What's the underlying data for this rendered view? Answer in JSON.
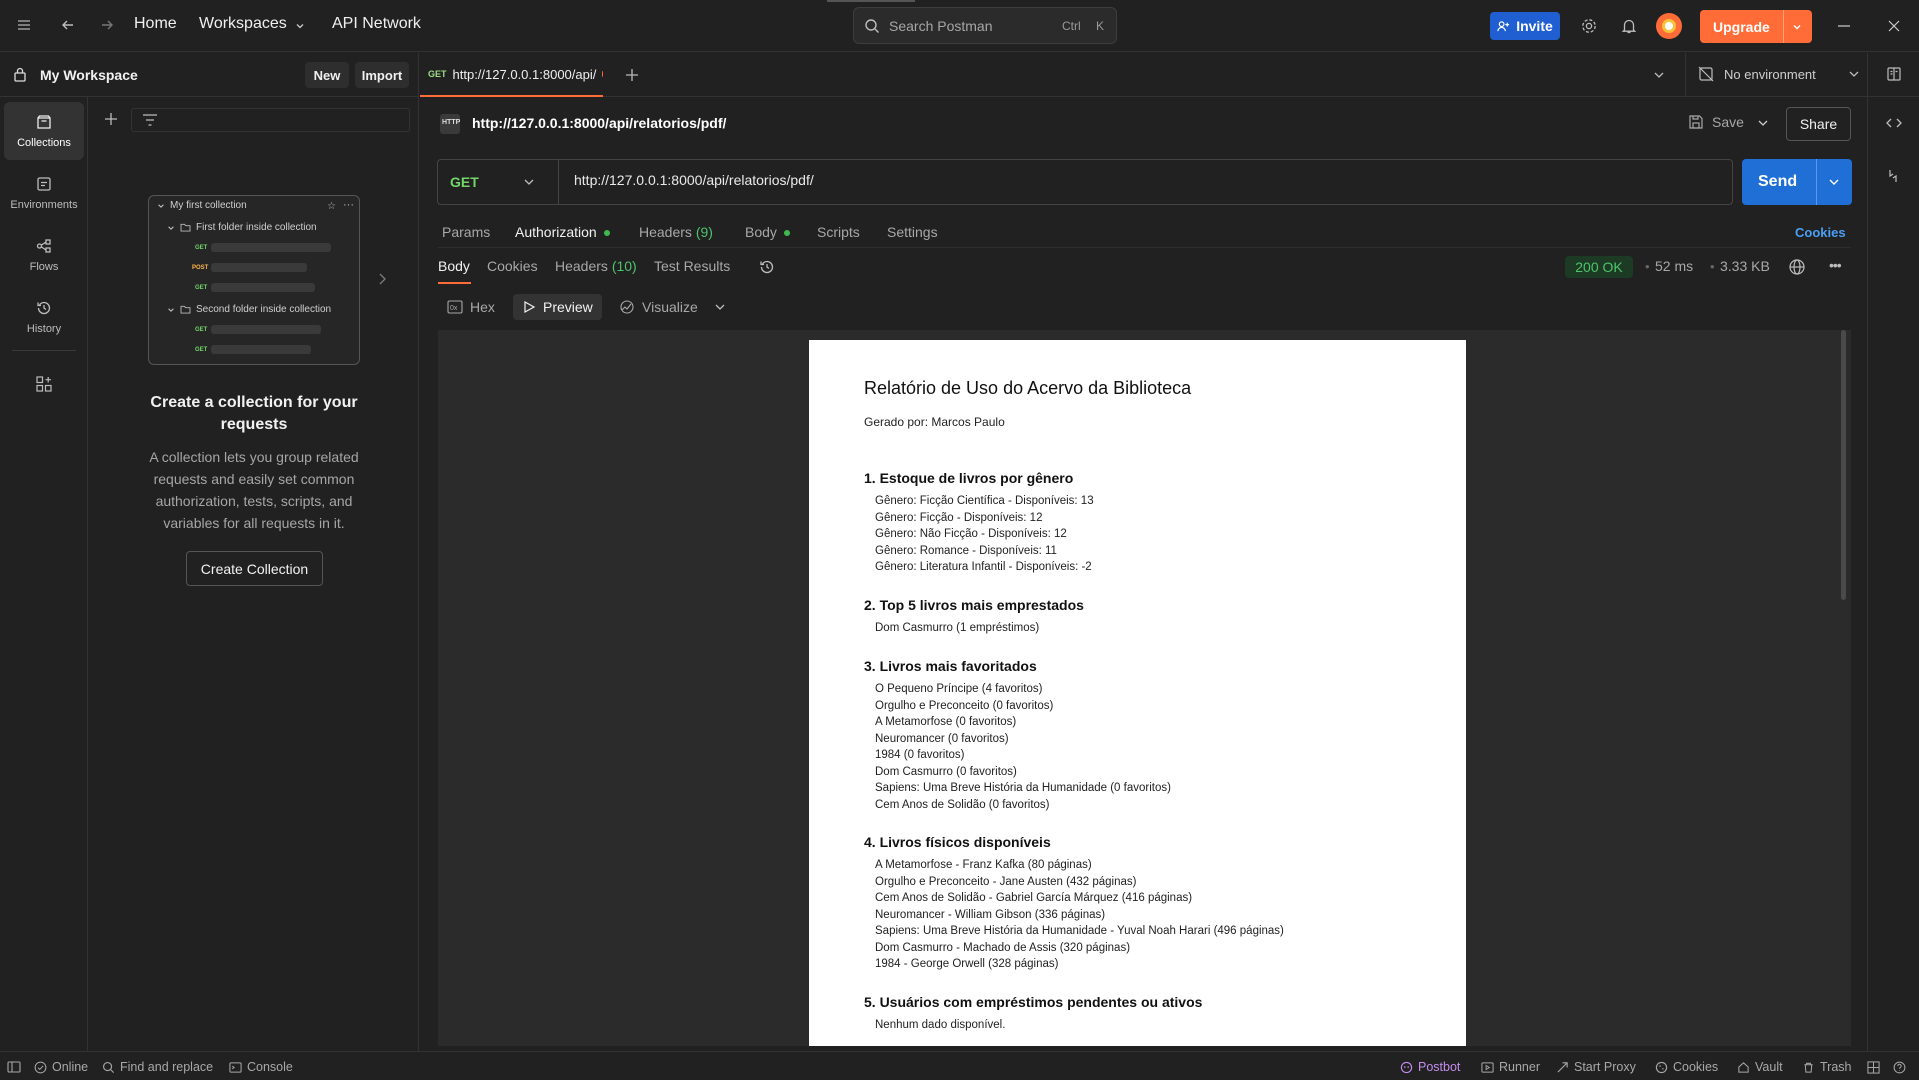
{
  "topbar": {
    "nav_home": "Home",
    "nav_workspaces": "Workspaces",
    "nav_api_network": "API Network",
    "search_placeholder": "Search Postman",
    "search_key1": "Ctrl",
    "search_key2": "K",
    "invite_label": "Invite",
    "upgrade_label": "Upgrade"
  },
  "workspace": {
    "title": "My Workspace",
    "new_label": "New",
    "import_label": "Import"
  },
  "rail": {
    "collections": "Collections",
    "environments": "Environments",
    "flows": "Flows",
    "history": "History"
  },
  "illustration": {
    "collection_name": "My first collection",
    "folder1": "First folder inside collection",
    "folder2": "Second folder inside collection",
    "m1": "GET",
    "m2": "POST",
    "m3": "GET",
    "m4": "GET",
    "m5": "GET"
  },
  "empty": {
    "title": "Create a collection for your requests",
    "description": "A collection lets you group related requests and easily set common authorization, tests, scripts, and variables for all requests in it.",
    "button": "Create Collection"
  },
  "tabs": {
    "active_method": "GET",
    "active_title": "http://127.0.0.1:8000/api/",
    "environment": "No environment"
  },
  "request": {
    "title": "http://127.0.0.1:8000/api/relatorios/pdf/",
    "save_label": "Save",
    "share_label": "Share",
    "method": "GET",
    "url": "http://127.0.0.1:8000/api/relatorios/pdf/",
    "send_label": "Send",
    "tab_params": "Params",
    "tab_authorization": "Authorization",
    "tab_headers": "Headers",
    "tab_headers_count": "(9)",
    "tab_body": "Body",
    "tab_scripts": "Scripts",
    "tab_settings": "Settings",
    "cookies_link": "Cookies"
  },
  "response": {
    "tab_body": "Body",
    "tab_cookies": "Cookies",
    "tab_headers": "Headers",
    "tab_headers_count": "(10)",
    "tab_test_results": "Test Results",
    "status": "200 OK",
    "time": "52 ms",
    "size": "3.33 KB",
    "view_hex": "Hex",
    "view_preview": "Preview",
    "view_visualize": "Visualize"
  },
  "pdf": {
    "title": "Relatório de Uso do Acervo da Biblioteca",
    "author": "Gerado por: Marcos Paulo",
    "sections": [
      {
        "heading": "1. Estoque de livros por gênero",
        "lines": [
          "Gênero: Ficção Científica - Disponíveis: 13",
          "Gênero: Ficção - Disponíveis: 12",
          "Gênero: Não Ficção - Disponíveis: 12",
          "Gênero: Romance - Disponíveis: 11",
          "Gênero: Literatura Infantil - Disponíveis: -2"
        ]
      },
      {
        "heading": "2. Top 5 livros mais emprestados",
        "lines": [
          "Dom Casmurro (1 empréstimos)"
        ]
      },
      {
        "heading": "3. Livros mais favoritados",
        "lines": [
          "O Pequeno Príncipe (4 favoritos)",
          "Orgulho e Preconceito (0 favoritos)",
          "A Metamorfose (0 favoritos)",
          "Neuromancer (0 favoritos)",
          "1984 (0 favoritos)",
          "Dom Casmurro (0 favoritos)",
          "Sapiens: Uma Breve História da Humanidade (0 favoritos)",
          "Cem Anos de Solidão (0 favoritos)"
        ]
      },
      {
        "heading": "4. Livros físicos disponíveis",
        "lines": [
          "A Metamorfose - Franz Kafka (80 páginas)",
          "Orgulho e Preconceito - Jane Austen (432 páginas)",
          "Cem Anos de Solidão - Gabriel García Márquez (416 páginas)",
          "Neuromancer - William Gibson (336 páginas)",
          "Sapiens: Uma Breve História da Humanidade - Yuval Noah Harari (496 páginas)",
          "Dom Casmurro - Machado de Assis (320 páginas)",
          "1984 - George Orwell (328 páginas)"
        ]
      },
      {
        "heading": "5. Usuários com empréstimos pendentes ou ativos",
        "lines": [
          "Nenhum dado disponível."
        ]
      }
    ]
  },
  "statusbar": {
    "online": "Online",
    "find_replace": "Find and replace",
    "console": "Console",
    "postbot": "Postbot",
    "runner": "Runner",
    "start_proxy": "Start Proxy",
    "cookies": "Cookies",
    "vault": "Vault",
    "trash": "Trash"
  },
  "colors": {
    "accent_orange": "#ff6c37",
    "send_blue": "#1f6fd6",
    "get_green": "#72d66a",
    "status_green": "#4ec46a"
  }
}
